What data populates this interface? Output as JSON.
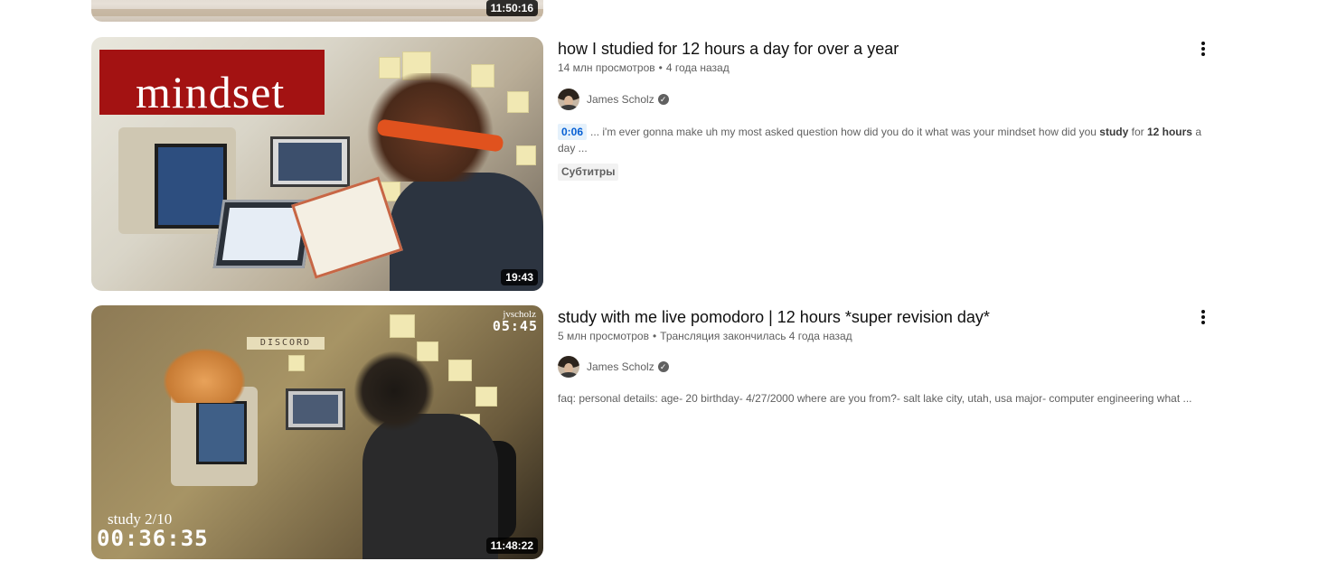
{
  "top_video": {
    "duration": "11:50:16"
  },
  "videos": [
    {
      "title": "how I studied for 12 hours a day for over a year",
      "views": "14 млн просмотров",
      "age": "4 года назад",
      "channel": "James Scholz",
      "duration": "19:43",
      "thumb_banner": "mindset",
      "snippet": {
        "timestamp": "0:06",
        "pre": "... i'm ever gonna make uh my most asked question how did you do it what was your mindset how did you ",
        "bold1": "study",
        "mid": " for ",
        "bold2": "12 hours",
        "post": " a day ..."
      },
      "badge": "Субтитры"
    },
    {
      "title": "study with me live pomodoro | 12 hours *super revision day*",
      "views": "5 млн просмотров",
      "age": "Трансляция закончилась 4 года назад",
      "channel": "James Scholz",
      "duration": "11:48:22",
      "thumb_overlay": {
        "ig_handle": "jvscholz",
        "small_clock": "05:45",
        "wall_sign": "DISCORD",
        "study_label": "study 2/10",
        "big_timer": "00:36:35"
      },
      "description": "faq: personal details: age- 20 birthday- 4/27/2000 where are you from?- salt lake city, utah, usa major- computer engineering what ..."
    }
  ],
  "icons": {
    "menu": "more-vert-icon",
    "verified": "verified-check-icon"
  }
}
